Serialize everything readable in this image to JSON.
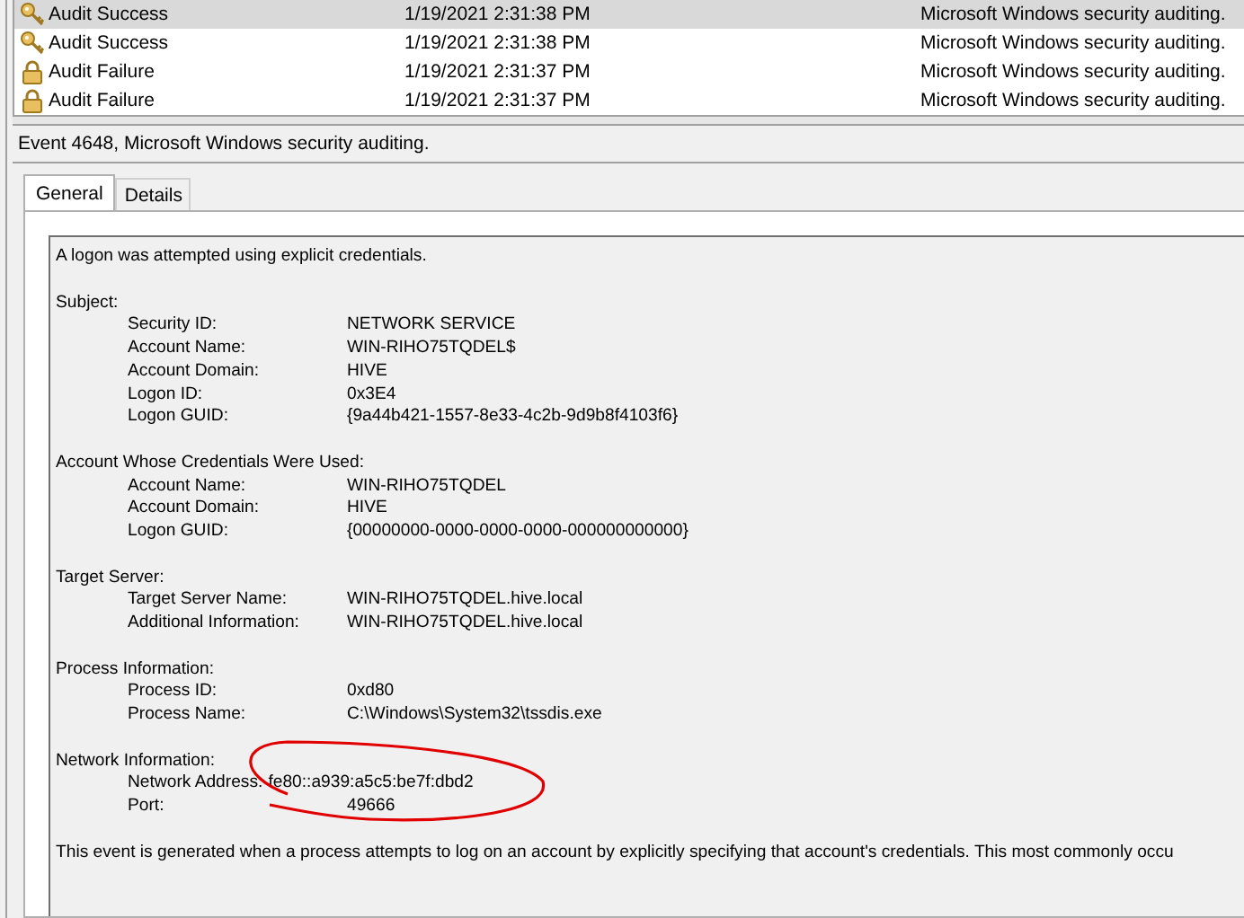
{
  "event_list": {
    "rows": [
      {
        "kind": "success",
        "keyword": "Audit Success",
        "date": "1/19/2021 2:31:38 PM",
        "source": "Microsoft Windows security auditing.",
        "selected": true
      },
      {
        "kind": "success",
        "keyword": "Audit Success",
        "date": "1/19/2021 2:31:38 PM",
        "source": "Microsoft Windows security auditing.",
        "selected": false
      },
      {
        "kind": "failure",
        "keyword": "Audit Failure",
        "date": "1/19/2021 2:31:37 PM",
        "source": "Microsoft Windows security auditing.",
        "selected": false
      },
      {
        "kind": "failure",
        "keyword": "Audit Failure",
        "date": "1/19/2021 2:31:37 PM",
        "source": "Microsoft Windows security auditing.",
        "selected": false
      }
    ]
  },
  "event_title": "Event 4648, Microsoft Windows security auditing.",
  "tabs": [
    {
      "label": "General",
      "selected": true
    },
    {
      "label": "Details",
      "selected": false
    }
  ],
  "description": {
    "summary": "A logon was attempted using explicit credentials.",
    "sections": [
      {
        "heading": "Subject:",
        "fields": [
          {
            "kind": "aligned",
            "label": "Security ID:",
            "value": "NETWORK SERVICE"
          },
          {
            "kind": "aligned",
            "label": "Account Name:",
            "value": "WIN-RIHO75TQDEL$"
          },
          {
            "kind": "aligned",
            "label": "Account Domain:",
            "value": "HIVE"
          },
          {
            "kind": "aligned",
            "label": "Logon ID:",
            "value": "0x3E4"
          },
          {
            "kind": "aligned",
            "label": "Logon GUID:",
            "value": "{9a44b421-1557-8e33-4c2b-9d9b8f4103f6}"
          }
        ]
      },
      {
        "heading": "Account Whose Credentials Were Used:",
        "fields": [
          {
            "kind": "aligned",
            "label": "Account Name:",
            "value": "WIN-RIHO75TQDEL"
          },
          {
            "kind": "aligned",
            "label": "Account Domain:",
            "value": "HIVE"
          },
          {
            "kind": "aligned",
            "label": "Logon GUID:",
            "value": "{00000000-0000-0000-0000-000000000000}"
          }
        ]
      },
      {
        "heading": "Target Server:",
        "fields": [
          {
            "kind": "aligned",
            "label": "Target Server Name:",
            "value": "WIN-RIHO75TQDEL.hive.local"
          },
          {
            "kind": "aligned",
            "label": "Additional Information:",
            "value": "WIN-RIHO75TQDEL.hive.local"
          }
        ]
      },
      {
        "heading": "Process Information:",
        "fields": [
          {
            "kind": "aligned",
            "label": "Process ID:",
            "value": "0xd80"
          },
          {
            "kind": "aligned",
            "label": "Process Name:",
            "value": "C:\\Windows\\System32\\tssdis.exe"
          }
        ]
      },
      {
        "heading": "Network Information:",
        "fields": [
          {
            "kind": "inline",
            "label": "Network Address:",
            "value": "fe80::a939:a5c5:be7f:dbd2"
          },
          {
            "kind": "aligned",
            "label": "Port:",
            "value": "49666"
          }
        ]
      }
    ],
    "footer": "This event is generated when a process attempts to log on an account by explicitly specifying that account's credentials.  This most commonly occu"
  }
}
